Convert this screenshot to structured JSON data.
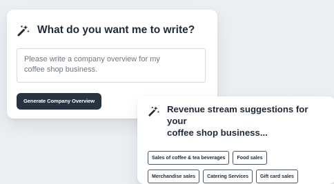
{
  "write_card": {
    "icon": "magic-wand-icon",
    "title": "What do you want me to write?",
    "prompt_text": "Please write a company overview for my\ncoffee shop business.",
    "button_label": "Generate Company Overview"
  },
  "suggestions_card": {
    "icon": "magic-wand-icon",
    "title": "Revenue stream suggestions for your\ncoffee shop business...",
    "chips_row_1": [
      "Sales of coffee & tea beverages",
      "Food sales"
    ],
    "chips_row_2": [
      "Merchandise sales",
      "Catering Services",
      "Gift card sales"
    ]
  }
}
